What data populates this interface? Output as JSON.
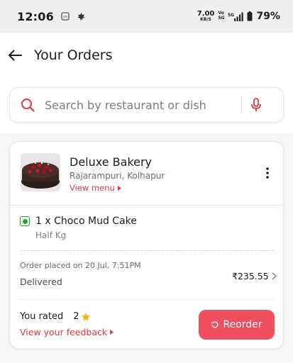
{
  "status_bar": {
    "time": "12:06",
    "net_speed": "7.00",
    "net_unit": "KB/S",
    "volte_top": "Vo",
    "volte_bottom": "5G",
    "battery": "79%"
  },
  "header": {
    "title": "Your Orders"
  },
  "search": {
    "placeholder": "Search by restaurant or dish"
  },
  "order": {
    "restaurant_name": "Deluxe Bakery",
    "restaurant_location": "Rajarampuri, Kolhapur",
    "view_menu_label": "View menu",
    "item": {
      "quantity_name": "1 x Choco Mud Cake",
      "variant": "Half Kg"
    },
    "placed_on": "Order placed on 20 Jul, 7:51PM",
    "status": "Delivered",
    "total": "₹235.55",
    "you_rated_label": "You rated",
    "rating": "2",
    "view_feedback_label": "View your feedback",
    "reorder_label": "Reorder"
  },
  "colors": {
    "accent": "#e23744",
    "reorder_button": "#ef4f5f",
    "veg": "#27a137",
    "star": "#f3b60f"
  }
}
